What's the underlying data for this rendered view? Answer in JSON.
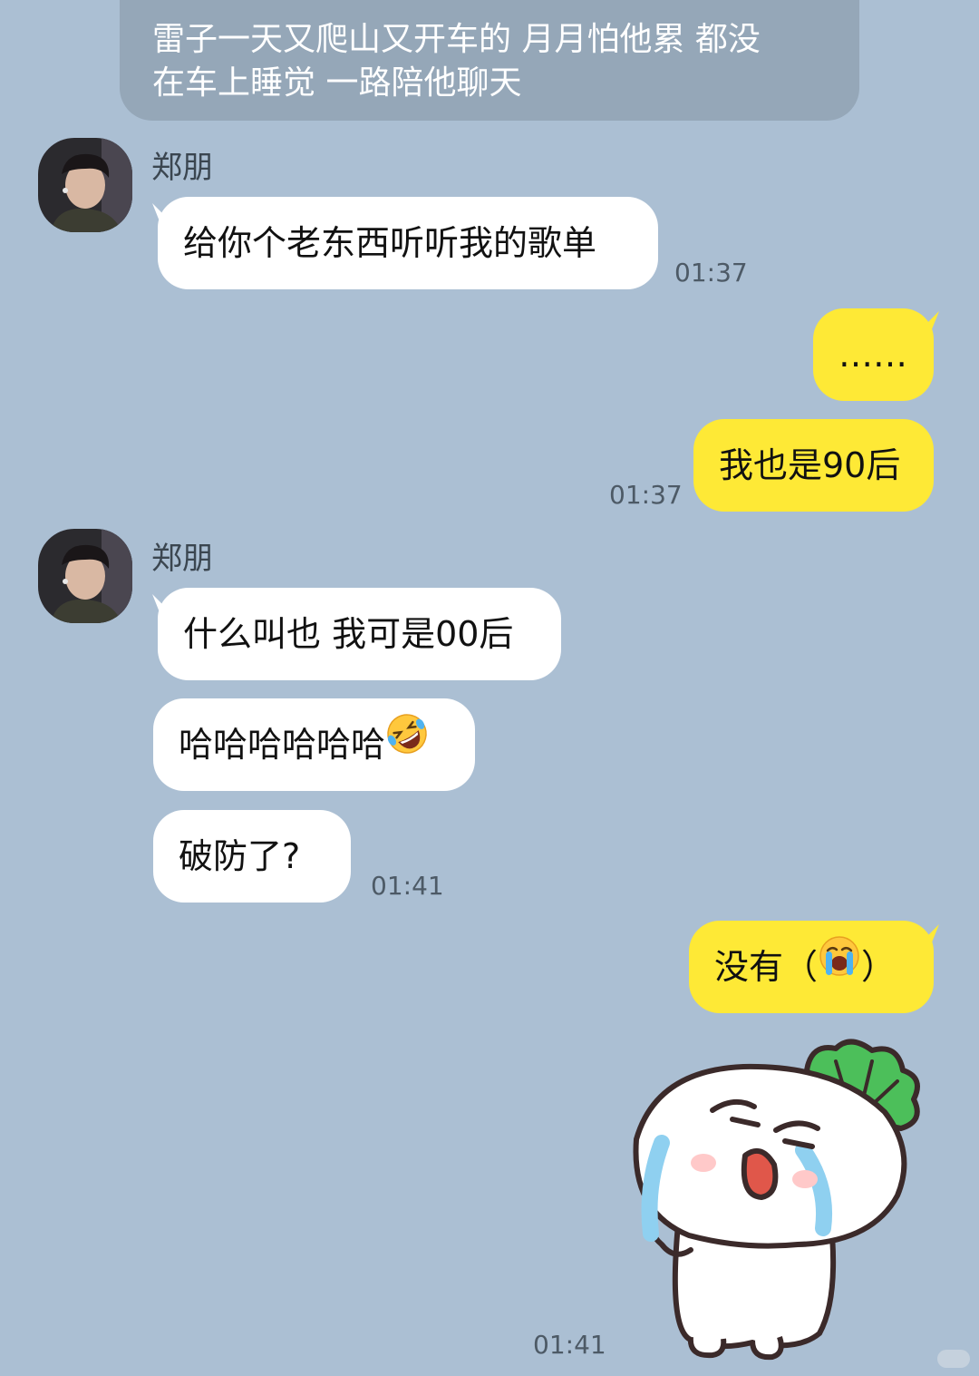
{
  "caption": {
    "line1": "雷子一天又爬山又开车的 月月怕他累 都没",
    "line2": "在车上睡觉 一路陪他聊天"
  },
  "messages": {
    "group1": {
      "sender": "郑朋",
      "bubble1": "给你个老东西听听我的歌单",
      "time": "01:37"
    },
    "group2": {
      "bubble1": "……",
      "bubble2": "我也是90后",
      "time": "01:37"
    },
    "group3": {
      "sender": "郑朋",
      "bubble1": "什么叫也 我可是00后",
      "bubble2": "哈哈哈哈哈哈",
      "bubble3": "破防了?",
      "time": "01:41"
    },
    "group4": {
      "bubble1": "没有（",
      "bubble1_end": "）",
      "time": "01:41"
    }
  },
  "icons": {
    "avatar": "avatar-photo",
    "laughing": "rolling-on-floor-laughing-emoji",
    "crying": "loudly-crying-emoji",
    "sticker": "crying-radish-sticker"
  },
  "colors": {
    "background": "#abbfd3",
    "incoming_bubble": "#ffffff",
    "outgoing_bubble": "#fee936",
    "caption_bg": "#95a7b8"
  }
}
